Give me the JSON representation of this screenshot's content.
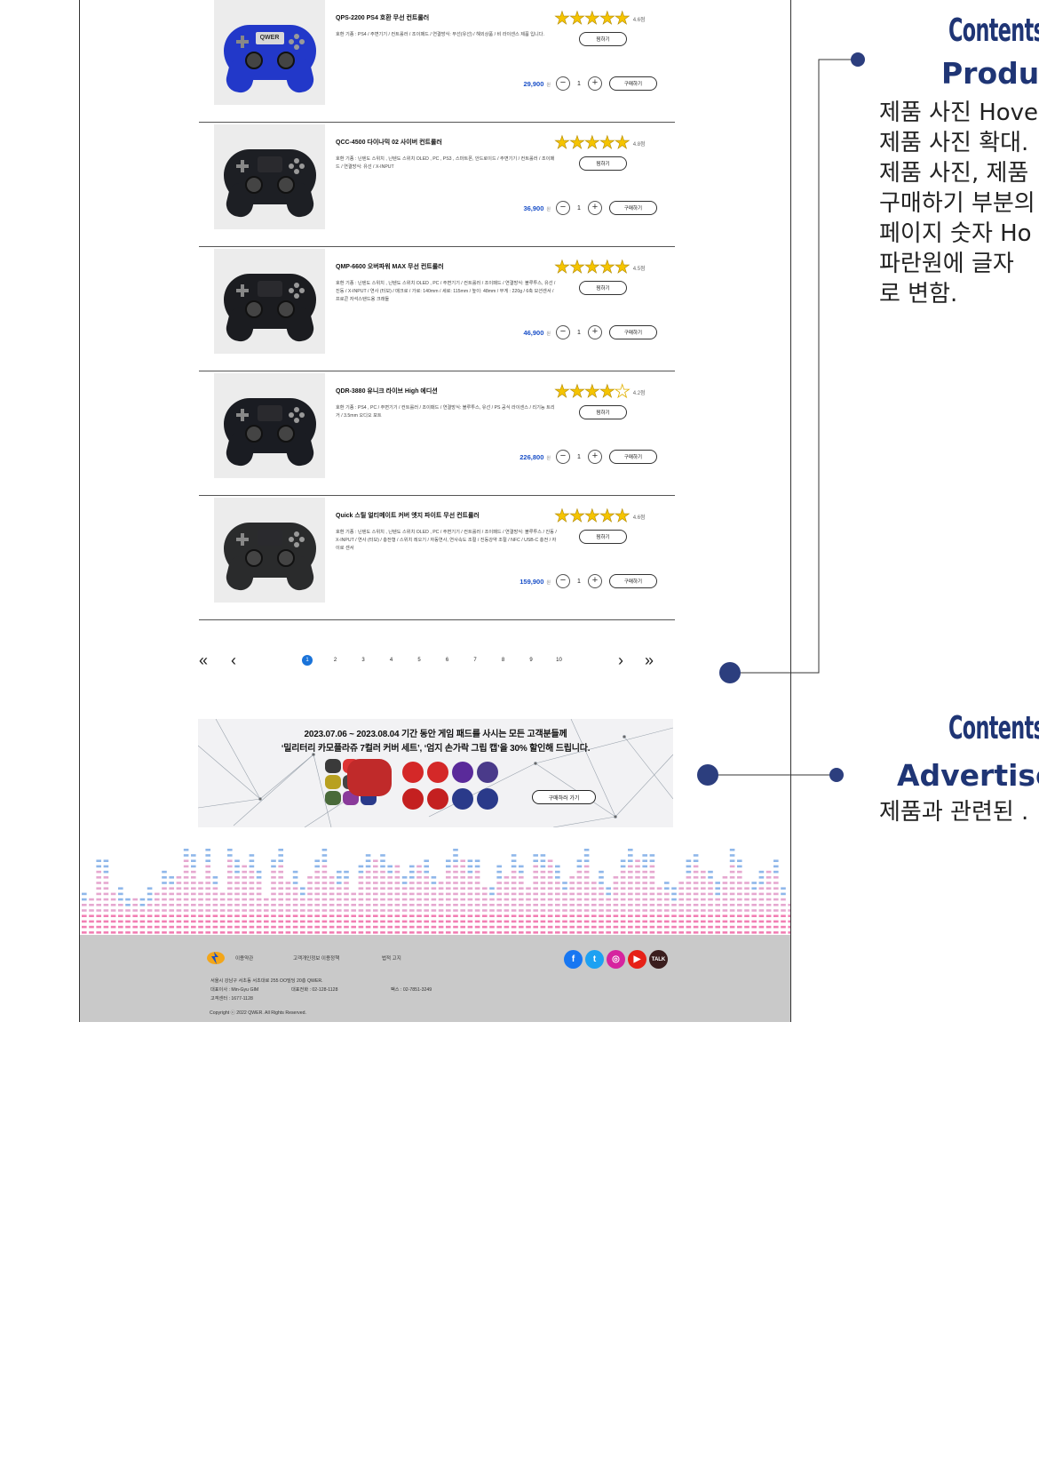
{
  "products": [
    {
      "name": "QPS-2200 PS4 호환 무선 컨트롤러",
      "desc": "호환 기종 : PS4 / 주변기기 / 컨트롤러 / 조이패드 / 연결방식: 무선(유선) / 해외상품 / 비 라이센스 제품 입니다.",
      "stars": 4.5,
      "rating": "4.6점",
      "price": "29,900",
      "currency": "원",
      "qty": "1",
      "wish": "찜하기",
      "buy": "구매하기",
      "color": "#2238c9",
      "screen": "QWER"
    },
    {
      "name": "QCC-4500 다이나믹 02 사이버 컨트롤러",
      "desc": "호환 기종 : 닌텐도 스위치 , 닌텐도 스위치 OLED , PC , PS3 , 스마트폰, 안드로이드 / 주변기기 / 컨트롤러 / 조이패드 / 연결방식: 유선 / X-INPUT",
      "stars": 4.5,
      "rating": "4.8점",
      "price": "36,900",
      "currency": "원",
      "qty": "1",
      "wish": "찜하기",
      "buy": "구매하기",
      "color": "#1d1f24",
      "screen": ""
    },
    {
      "name": "QMP-6600 오버파워 MAX 무선 컨트롤러",
      "desc": "호환 기종 : 닌텐도 스위치 , 닌텐도 스위치 OLED , PC / 주변기기 / 컨트롤러 / 조이패드 / 연결방식: 블루투스, 유선 / 진동 / X-INPUT / 연사 (터보) / 매크로 / 가로: 140mm / 세로: 115mm / 높이: 48mm / 무게 : 220g / 6축 모션센서 / 프로콘 자석스탠드용 크래들",
      "stars": 4.5,
      "rating": "4.5점",
      "price": "46,900",
      "currency": "원",
      "qty": "1",
      "wish": "찜하기",
      "buy": "구매하기",
      "color": "#1b1c20",
      "screen": ""
    },
    {
      "name": "QDR-3880 유니크 라이브 High 에디션",
      "desc": "호환 기종 : PS4 , PC / 주변기기 / 컨트롤러 / 조이패드 / 연결방식: 블루투스, 유선 / PS 공식 라이센스 / 리기능 트리거 / 3.5mm 오디오 포트",
      "stars": 4,
      "rating": "4.2점",
      "price": "226,800",
      "currency": "원",
      "qty": "1",
      "wish": "찜하기",
      "buy": "구매하기",
      "color": "#1a1c22",
      "screen": ""
    },
    {
      "name": "Quick 스틸 얼티메이트 커버 엣지 파이트 무선 컨트롤러",
      "desc": "호환 기종 : 닌텐도 스위치 , 닌텐도 스위치 OLED , PC / 주변기기 / 컨트롤러 / 조이패드 / 연결방식: 블루투스 / 진동 / X-INPUT / 연사 (터보) / 충전형 / 스위치 레오기 / 자동연사, 연사속도 조절 / 진동강약 조절 / NFC / USB-C 충전 / 자이로 센서",
      "stars": 4.5,
      "rating": "4.6점",
      "price": "159,900",
      "currency": "원",
      "qty": "1",
      "wish": "찜하기",
      "buy": "구매하기",
      "color": "#2a2b2c",
      "screen": ""
    }
  ],
  "pagination": {
    "first": "«",
    "prev": "‹",
    "next": "›",
    "last": "»",
    "pages": [
      "1",
      "2",
      "3",
      "4",
      "5",
      "6",
      "7",
      "8",
      "9",
      "10"
    ],
    "active": "1"
  },
  "ad": {
    "line1": "2023.07.06 ~ 2023.08.04 기간 동안 게임 패드를 사시는 모든 고객분들께",
    "line2": "‘밀리터리 카모플라쥬 7컬러 커버 세트’, ‘엄지 손가락 그립 캡’을 30% 할인해 드립니다.",
    "button": "구매하러 가기"
  },
  "footer": {
    "links": [
      "이용약관",
      "고객개인정보 이용정책",
      "법적 고지"
    ],
    "address": "서울시 강남구 서초동 서초대로 255 OO빌딩 20층 QWER.",
    "ceo": "대표이사 : Min-Gyu GIM",
    "tel": "대표전화 : 02-128-1128",
    "fax": "팩스 : 02-7851-3249",
    "center": "고객센터 : 1677-1128",
    "copyright": "Copyright ⓒ 2022 QWER. All Rights Reserved.",
    "socials": [
      {
        "name": "facebook",
        "glyph": "f",
        "color": "#1877f2"
      },
      {
        "name": "twitter",
        "glyph": "t",
        "color": "#1da1f2"
      },
      {
        "name": "instagram",
        "glyph": "◎",
        "color": "#d6249f"
      },
      {
        "name": "youtube",
        "glyph": "▶",
        "color": "#e62117"
      },
      {
        "name": "kakaotalk",
        "glyph": "TALK",
        "color": "#3a1d1d"
      }
    ]
  },
  "annotations": {
    "product": {
      "title": "Contents",
      "subtitle": "Produc",
      "lines": [
        "제품 사진 Hove",
        "제품 사진 확대.",
        "제품 사진, 제품",
        "구매하기 부분의",
        "페이지 숫자 Ho",
        "파란원에 글자",
        "로 변함."
      ]
    },
    "advert": {
      "title": "Contents",
      "subtitle": "Advertise",
      "lines": [
        "제품과 관련된 ."
      ]
    }
  },
  "colors": {
    "accent": "#1a50c8",
    "pagination_active": "#1a73d9",
    "annotation": "#1f3575",
    "footer_bg": "#c9c9c9"
  }
}
